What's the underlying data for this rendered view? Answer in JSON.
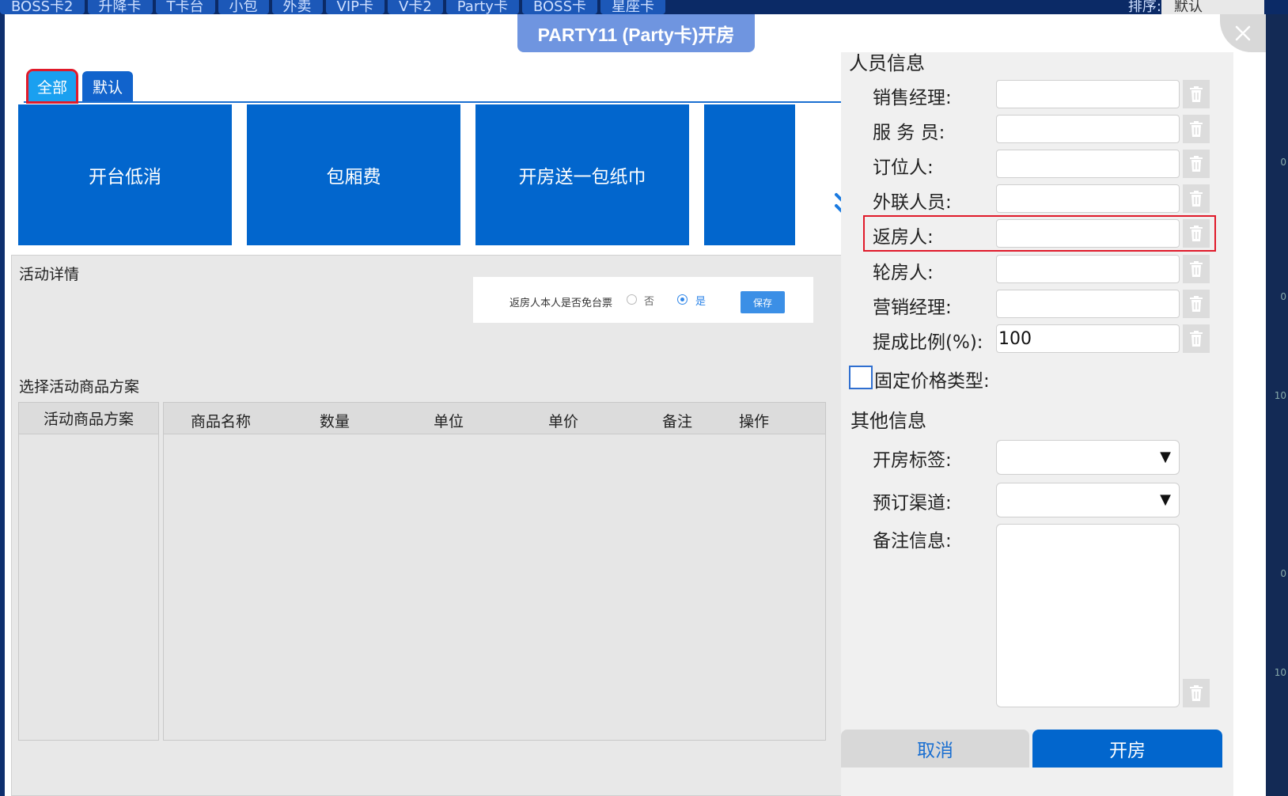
{
  "background": {
    "tabs": [
      "BOSS卡2",
      "升降卡",
      "T卡台",
      "小包",
      "外卖",
      "VIP卡",
      "V卡2",
      "Party卡",
      "BOSS卡",
      "星座卡"
    ],
    "sort_label": "排序:",
    "sort_value": "默认",
    "side_numbers": [
      "0",
      "0",
      "10",
      "0",
      "10"
    ]
  },
  "dialog": {
    "title": "PARTY11 (Party卡)开房",
    "close_icon": "close-icon"
  },
  "category_tabs": [
    {
      "label": "全部",
      "active": true
    },
    {
      "label": "默认",
      "active": false
    }
  ],
  "activity_tiles": [
    "开台低消",
    "包厢费",
    "开房送一包纸巾"
  ],
  "activity_detail": {
    "heading": "活动详情",
    "question": "返房人本人是否免台票",
    "options": [
      {
        "label": "否",
        "checked": false
      },
      {
        "label": "是",
        "checked": true
      }
    ],
    "save_label": "保存"
  },
  "goods_plan": {
    "heading": "选择活动商品方案",
    "plan_header": "活动商品方案",
    "columns": [
      "商品名称",
      "数量",
      "单位",
      "单价",
      "备注",
      "操作"
    ],
    "rows": []
  },
  "personnel": {
    "heading": "人员信息",
    "fields": [
      {
        "label": "销售经理:",
        "value": ""
      },
      {
        "label": "服 务 员:",
        "value": ""
      },
      {
        "label": "订位人:",
        "value": ""
      },
      {
        "label": "外联人员:",
        "value": ""
      },
      {
        "label": "返房人:",
        "value": ""
      },
      {
        "label": "轮房人:",
        "value": ""
      },
      {
        "label": "营销经理:",
        "value": ""
      },
      {
        "label": "提成比例(%):",
        "value": "100"
      }
    ],
    "fixed_price_label": "固定价格类型:",
    "fixed_price_checked": false
  },
  "other_info": {
    "heading": "其他信息",
    "open_tag_label": "开房标签:",
    "open_tag_value": "",
    "channel_label": "预订渠道:",
    "channel_value": "",
    "remark_label": "备注信息:",
    "remark_value": ""
  },
  "actions": {
    "cancel_label": "取消",
    "open_label": "开房"
  },
  "colors": {
    "primary": "#0266cd",
    "title_pill": "#6f95e0",
    "highlight": "#e01a2a",
    "active_tab": "#1aa0f0"
  }
}
